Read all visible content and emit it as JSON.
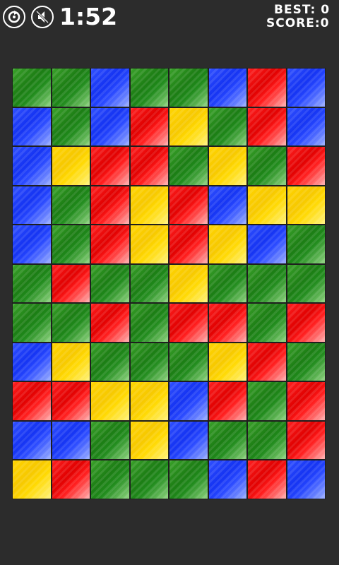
{
  "hud": {
    "timer": "1:52",
    "best_text": "BEST: 0",
    "score_text": "SCORE:0",
    "restart_icon": "restart-icon",
    "sound_icon": "sound-muted-icon"
  },
  "colors": {
    "green": "#1f8a1b",
    "blue": "#1f3cff",
    "red": "#f00000",
    "yellow": "#ffd400",
    "background": "#2c2c2c"
  },
  "board": {
    "rows": [
      [
        "green",
        "green",
        "blue",
        "green",
        "green",
        "blue",
        "red",
        "blue"
      ],
      [
        "blue",
        "green",
        "blue",
        "red",
        "yellow",
        "green",
        "red",
        "blue"
      ],
      [
        "blue",
        "yellow",
        "red",
        "red",
        "green",
        "yellow",
        "green",
        "red"
      ],
      [
        "blue",
        "green",
        "red",
        "yellow",
        "red",
        "blue",
        "yellow",
        "yellow"
      ],
      [
        "blue",
        "green",
        "red",
        "yellow",
        "red",
        "yellow",
        "blue",
        "green"
      ],
      [
        "green",
        "red",
        "green",
        "green",
        "yellow",
        "green",
        "green",
        "green"
      ],
      [
        "green",
        "green",
        "red",
        "green",
        "red",
        "red",
        "green",
        "red"
      ],
      [
        "blue",
        "yellow",
        "green",
        "green",
        "green",
        "yellow",
        "red",
        "green"
      ],
      [
        "red",
        "red",
        "yellow",
        "yellow",
        "blue",
        "red",
        "green",
        "red"
      ],
      [
        "blue",
        "blue",
        "green",
        "yellow",
        "blue",
        "green",
        "green",
        "red"
      ],
      [
        "yellow",
        "red",
        "green",
        "green",
        "green",
        "blue",
        "red",
        "blue"
      ]
    ]
  }
}
